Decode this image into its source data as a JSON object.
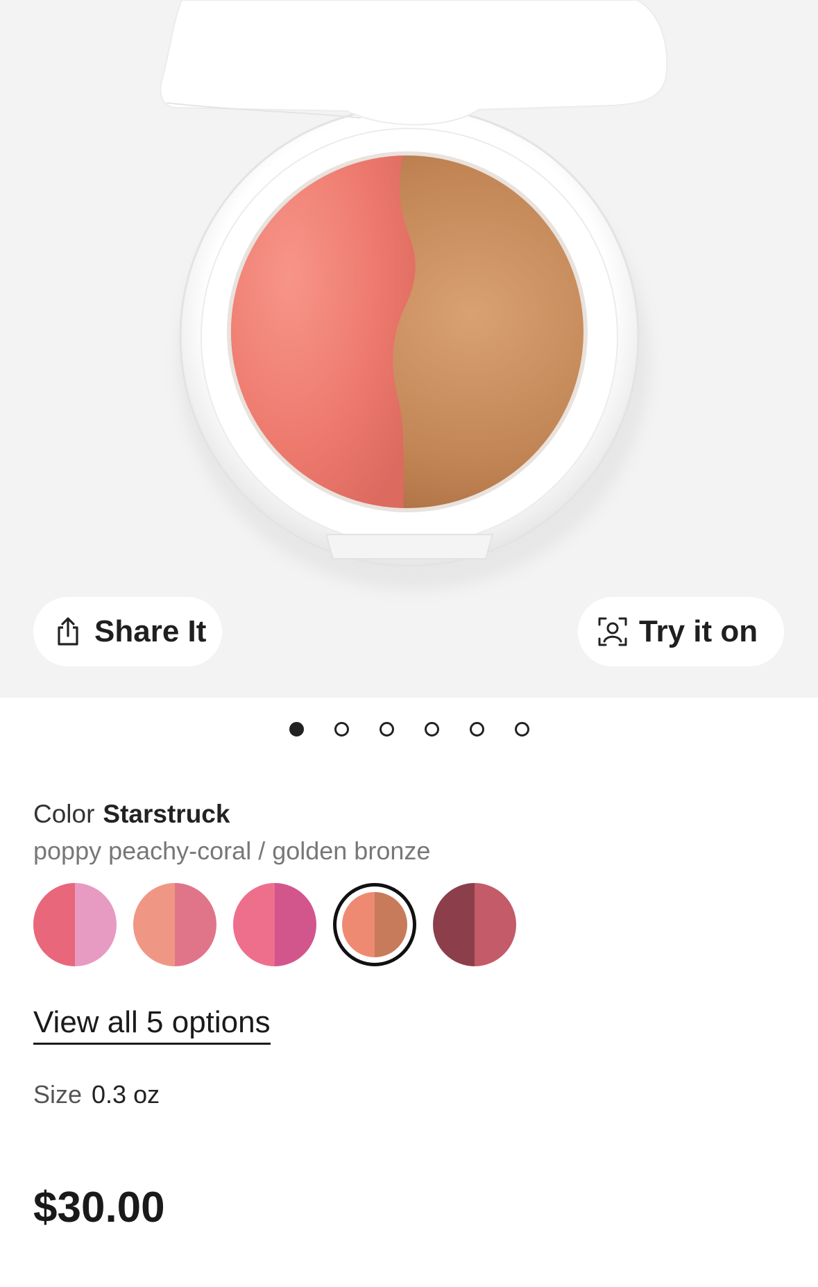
{
  "gallery": {
    "share_label": "Share It",
    "tryon_label": "Try it on",
    "slide_count": 6,
    "active_slide": 1
  },
  "product": {
    "color_label": "Color",
    "color_value": "Starstruck",
    "color_description": "poppy peachy-coral / golden bronze",
    "swatches": [
      {
        "left": "#e8677a",
        "right": "#e79ac2",
        "selected": false
      },
      {
        "left": "#ef9784",
        "right": "#e07589",
        "selected": false
      },
      {
        "left": "#ee6f8c",
        "right": "#d2568c",
        "selected": false
      },
      {
        "left": "#ef8a72",
        "right": "#c77b5b",
        "selected": true
      },
      {
        "left": "#8c3f4a",
        "right": "#c35b68",
        "selected": false
      }
    ],
    "view_all_label": "View all 5 options",
    "size_label": "Size",
    "size_value": "0.3 oz",
    "price": "$30.00"
  }
}
